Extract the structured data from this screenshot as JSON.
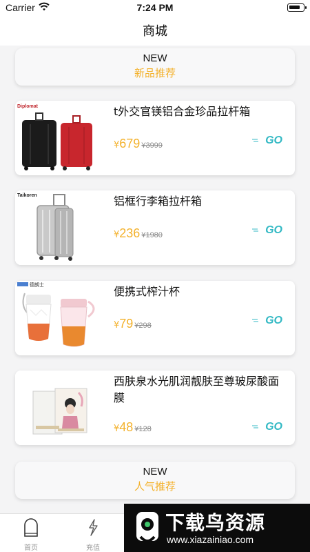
{
  "status_bar": {
    "carrier": "Carrier",
    "time": "7:24 PM"
  },
  "nav": {
    "title": "商城"
  },
  "sections": {
    "new_products": {
      "tag": "NEW",
      "title": "新品推荐"
    },
    "popular": {
      "tag": "NEW",
      "title": "人气推荐"
    }
  },
  "currency_symbol": "¥",
  "accent_color": "#f3b12b",
  "go_color": "#33b9c4",
  "products": [
    {
      "name": "t外交官镁铝合金珍品拉杆箱",
      "price": "679",
      "original_price": "¥3999",
      "image_brand": "Diplomat",
      "image_icon": "luggage-pair-icon",
      "go_label": "GO"
    },
    {
      "name": "铝框行李箱拉杆箱",
      "price": "236",
      "original_price": "¥1980",
      "image_brand": "Taikoren",
      "image_icon": "silver-luggage-icon",
      "go_label": "GO"
    },
    {
      "name": "便携式榨汁杯",
      "price": "79",
      "original_price": "¥298",
      "image_brand": "德朗士",
      "image_icon": "juicer-cup-icon",
      "go_label": "GO"
    },
    {
      "name": "西肤泉水光肌润靓肤至尊玻尿酸面膜",
      "price": "48",
      "original_price": "¥128",
      "image_brand": "",
      "image_icon": "face-mask-box-icon",
      "go_label": "GO"
    }
  ],
  "tabs": [
    {
      "label": "首页",
      "icon": "home-icon"
    },
    {
      "label": "充值",
      "icon": "lightning-icon"
    }
  ],
  "watermark": {
    "title": "下载鸟资源",
    "url": "www.xiazainiao.com"
  }
}
